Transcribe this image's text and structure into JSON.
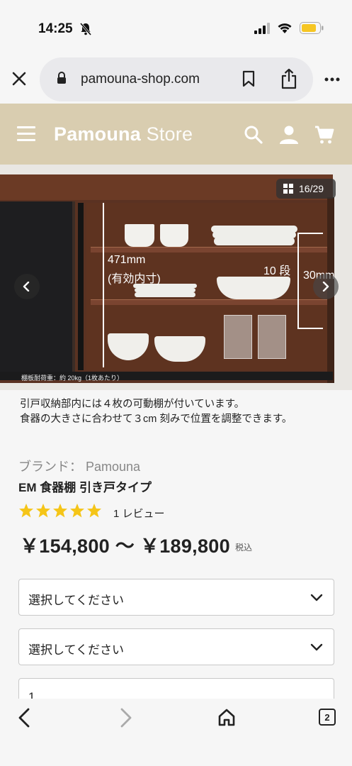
{
  "status": {
    "time": "14:25",
    "icons": [
      "bell-muted-icon",
      "signal-icon",
      "wifi-icon",
      "battery-icon"
    ],
    "battery_color": "#f6c623"
  },
  "browser": {
    "url": "pamouna-shop.com",
    "icons": [
      "close-icon",
      "lock-icon",
      "bookmark-icon",
      "share-icon",
      "more-icon"
    ]
  },
  "header": {
    "brand_bold": "Pamouna",
    "brand_light": "Store",
    "bg_color": "#d9cdb0",
    "icons": [
      "menu-icon",
      "search-icon",
      "account-icon",
      "cart-icon"
    ]
  },
  "hero": {
    "photo_index": "16/29",
    "height_label": "471mm",
    "height_sublabel": "(有効内寸)",
    "steps_label": "10 段",
    "pitch_label": "30mm",
    "load_note": "棚板耐荷重：約 20kg（1枚あたり）"
  },
  "caption": {
    "line1": "引戸収納部内には４枚の可動棚が付いています。",
    "line2": "食器の大きさに合わせて３cm 刻みで位置を調整できます。"
  },
  "product": {
    "brand_line": "ブランド： Pamouna",
    "title": "EM 食器棚 引き戸タイプ",
    "rating": 5,
    "star_color": "#f5c518",
    "review_count": "1 レビュー",
    "price": "￥154,800 〜 ￥189,800",
    "tax_note": "税込"
  },
  "options": {
    "select1": "選択してください",
    "select2": "選択してください",
    "quantity": "1"
  },
  "bottom_nav": {
    "tab_count": "2",
    "icons": [
      "back-icon",
      "forward-icon",
      "home-icon",
      "tabs-icon"
    ]
  }
}
